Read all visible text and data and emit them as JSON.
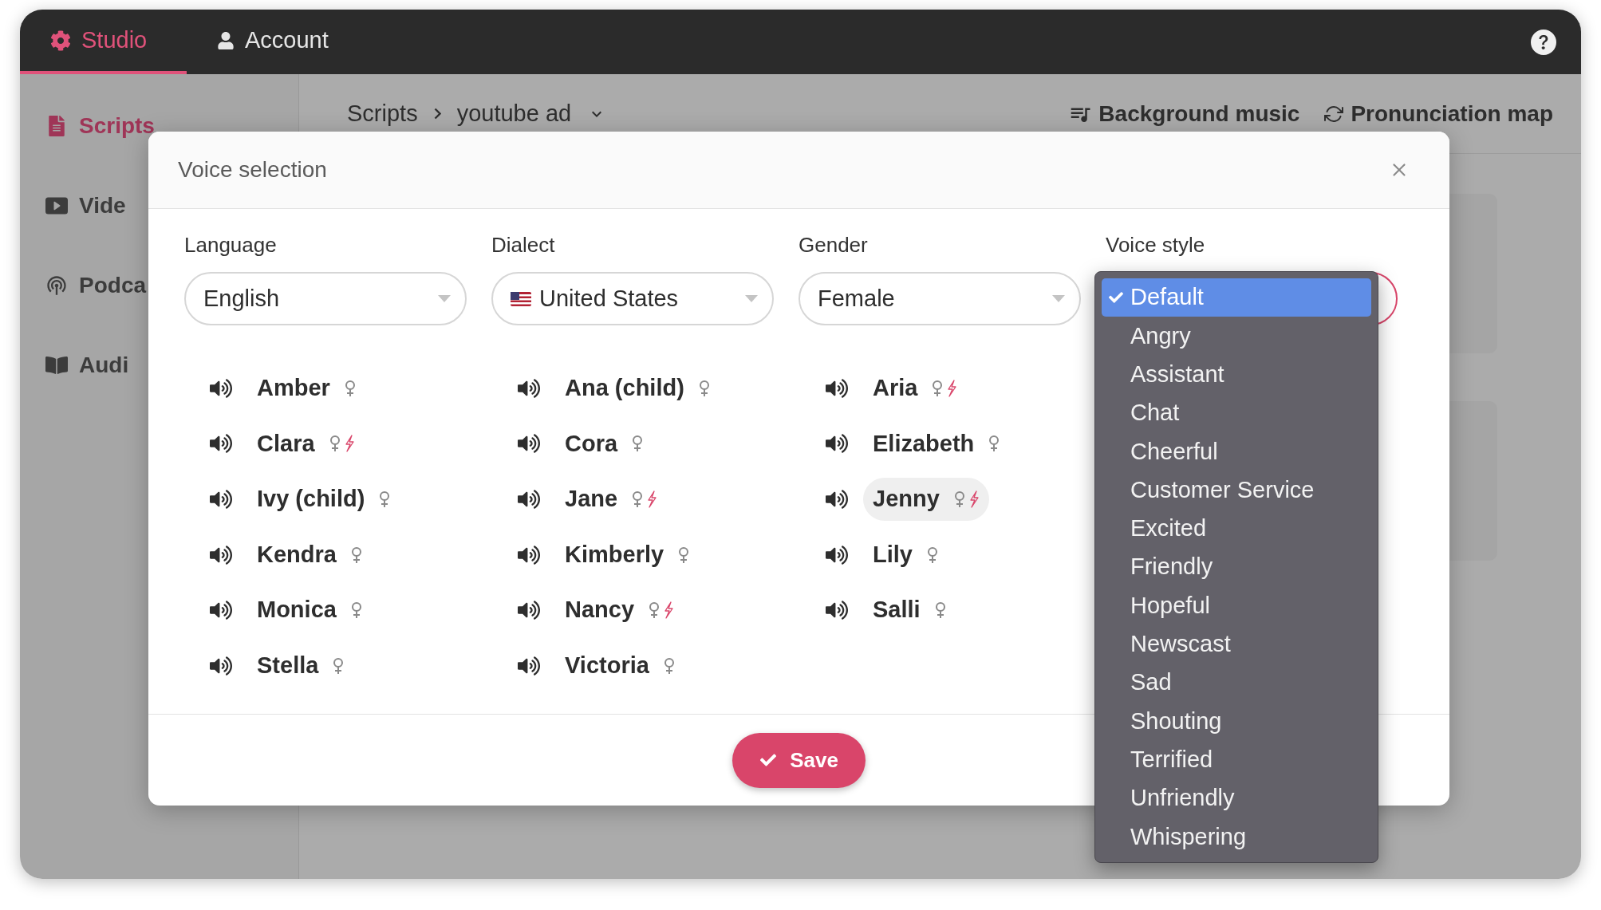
{
  "top_nav": {
    "tabs": [
      {
        "label": "Studio",
        "kind": "studio",
        "selected": true
      },
      {
        "label": "Account",
        "kind": "account",
        "selected": false
      }
    ]
  },
  "sidebar": {
    "items": [
      {
        "label": "Scripts",
        "kind": "document",
        "selected": true
      },
      {
        "label": "Vide",
        "kind": "video",
        "selected": false
      },
      {
        "label": "Podca",
        "kind": "podcast",
        "selected": false
      },
      {
        "label": "Audi",
        "kind": "book",
        "selected": false
      }
    ]
  },
  "breadcrumb": {
    "items": [
      "Scripts",
      "youtube ad"
    ]
  },
  "toolbar": {
    "actions": [
      {
        "label": "Background music",
        "kind": "music"
      },
      {
        "label": "Pronunciation map",
        "kind": "sync"
      }
    ]
  },
  "dialog": {
    "title": "Voice selection",
    "filters": [
      {
        "label": "Language",
        "value": "English",
        "kind": "select"
      },
      {
        "label": "Dialect",
        "value": "United States",
        "kind": "flag"
      },
      {
        "label": "Gender",
        "value": "Female",
        "kind": "select"
      },
      {
        "label": "Voice style",
        "kind": "open"
      }
    ],
    "voices": [
      {
        "name": "Amber",
        "neural": false,
        "selected": false
      },
      {
        "name": "Ana (child)",
        "neural": false,
        "selected": false
      },
      {
        "name": "Aria",
        "neural": true,
        "selected": false
      },
      {
        "name": "Clara",
        "neural": true,
        "selected": false
      },
      {
        "name": "Cora",
        "neural": false,
        "selected": false
      },
      {
        "name": "Elizabeth",
        "neural": false,
        "selected": false
      },
      {
        "name": "Ivy (child)",
        "neural": false,
        "selected": false
      },
      {
        "name": "Jane",
        "neural": true,
        "selected": false
      },
      {
        "name": "Jenny",
        "neural": true,
        "selected": true
      },
      {
        "name": "Kendra",
        "neural": false,
        "selected": false
      },
      {
        "name": "Kimberly",
        "neural": false,
        "selected": false
      },
      {
        "name": "Lily",
        "neural": false,
        "selected": false
      },
      {
        "name": "Monica",
        "neural": false,
        "selected": false
      },
      {
        "name": "Nancy",
        "neural": true,
        "selected": false
      },
      {
        "name": "Salli",
        "neural": false,
        "selected": false
      },
      {
        "name": "Stella",
        "neural": false,
        "selected": false
      },
      {
        "name": "Victoria",
        "neural": false,
        "selected": false
      }
    ],
    "save_button": "Save"
  },
  "voice_style_menu": {
    "options": [
      {
        "label": "Default",
        "selected": true
      },
      {
        "label": "Angry",
        "selected": false
      },
      {
        "label": "Assistant",
        "selected": false
      },
      {
        "label": "Chat",
        "selected": false
      },
      {
        "label": "Cheerful",
        "selected": false
      },
      {
        "label": "Customer Service",
        "selected": false
      },
      {
        "label": "Excited",
        "selected": false
      },
      {
        "label": "Friendly",
        "selected": false
      },
      {
        "label": "Hopeful",
        "selected": false
      },
      {
        "label": "Newscast",
        "selected": false
      },
      {
        "label": "Sad",
        "selected": false
      },
      {
        "label": "Shouting",
        "selected": false
      },
      {
        "label": "Terrified",
        "selected": false
      },
      {
        "label": "Unfriendly",
        "selected": false
      },
      {
        "label": "Whispering",
        "selected": false
      }
    ]
  }
}
